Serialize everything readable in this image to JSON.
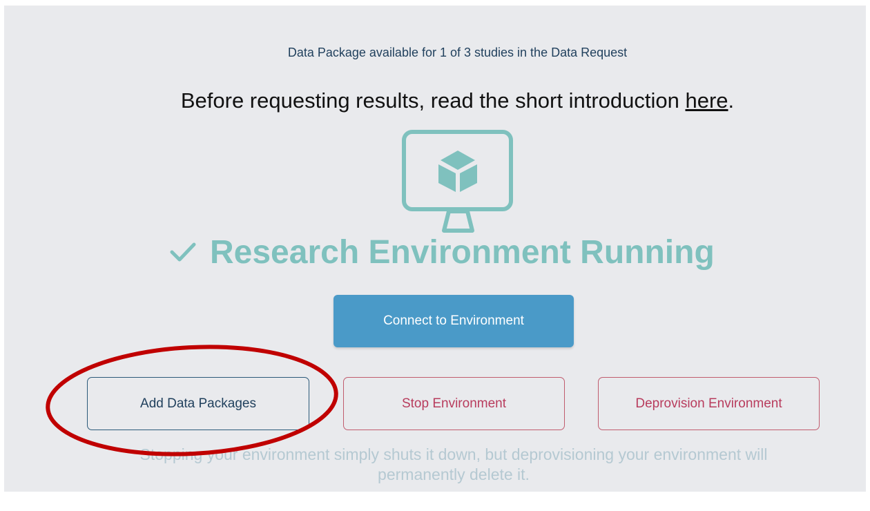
{
  "availability_text": "Data Package available for 1 of 3 studies in the Data Request",
  "intro": {
    "prefix": "Before requesting results, read the short introduction ",
    "link_label": "here",
    "suffix": "."
  },
  "status": {
    "icon": "check-icon",
    "text": "Research Environment Running"
  },
  "buttons": {
    "connect": "Connect to Environment",
    "add_packages": "Add Data Packages",
    "stop": "Stop Environment",
    "deprovision": "Deprovision Environment"
  },
  "note": "Stopping your environment simply shuts it down, but deprovisioning your environment will permanently delete it.",
  "colors": {
    "accent_teal": "#7fc1be",
    "primary_button": "#4a9ac8",
    "danger": "#b83c5d",
    "annotation_red": "#c00000"
  }
}
